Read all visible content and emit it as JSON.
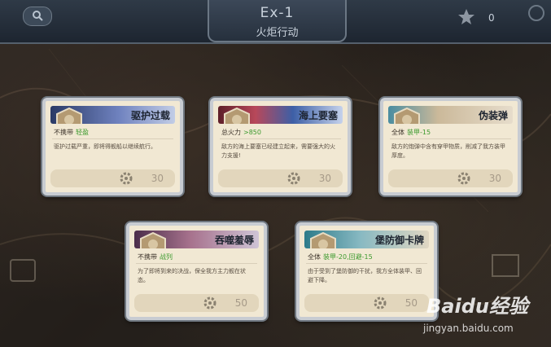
{
  "header": {
    "title": "Ex-1",
    "subtitle": "火炬行动",
    "medal_count": "0"
  },
  "cards": [
    {
      "name": "驱护过载",
      "banner": "blue",
      "scope": "不携带",
      "effect": "轻盈",
      "desc": "驱护过载严重，即将得舰船以继续航行。",
      "cost": "30"
    },
    {
      "name": "海上要塞",
      "banner": "red",
      "scope": "总火力",
      "effect": ">850",
      "desc": "敌方的海上要塞已经建立起来，需要强大的火力支援!",
      "cost": "30"
    },
    {
      "name": "伪装弹",
      "banner": "tan",
      "scope": "全体",
      "effect": "装甲-15",
      "desc": "敌方的炮弹中含有穿甲物质，削减了我方装甲厚度。",
      "cost": "30"
    },
    {
      "name": "吞噬羞辱",
      "banner": "pink",
      "scope": "不携带",
      "effect": "战列",
      "desc": "为了即将到来的决战，保全我方主力舰在状态。",
      "cost": "50"
    },
    {
      "name": "堡防御卡牌",
      "banner": "teal",
      "scope": "全体",
      "effect": "装甲-20,回避-15",
      "desc": "由于受到了堡防御的干扰，我方全体装甲、回避下降。",
      "cost": "50"
    }
  ],
  "watermark": {
    "logo": "Baidu经验",
    "url": "jingyan.baidu.com"
  }
}
